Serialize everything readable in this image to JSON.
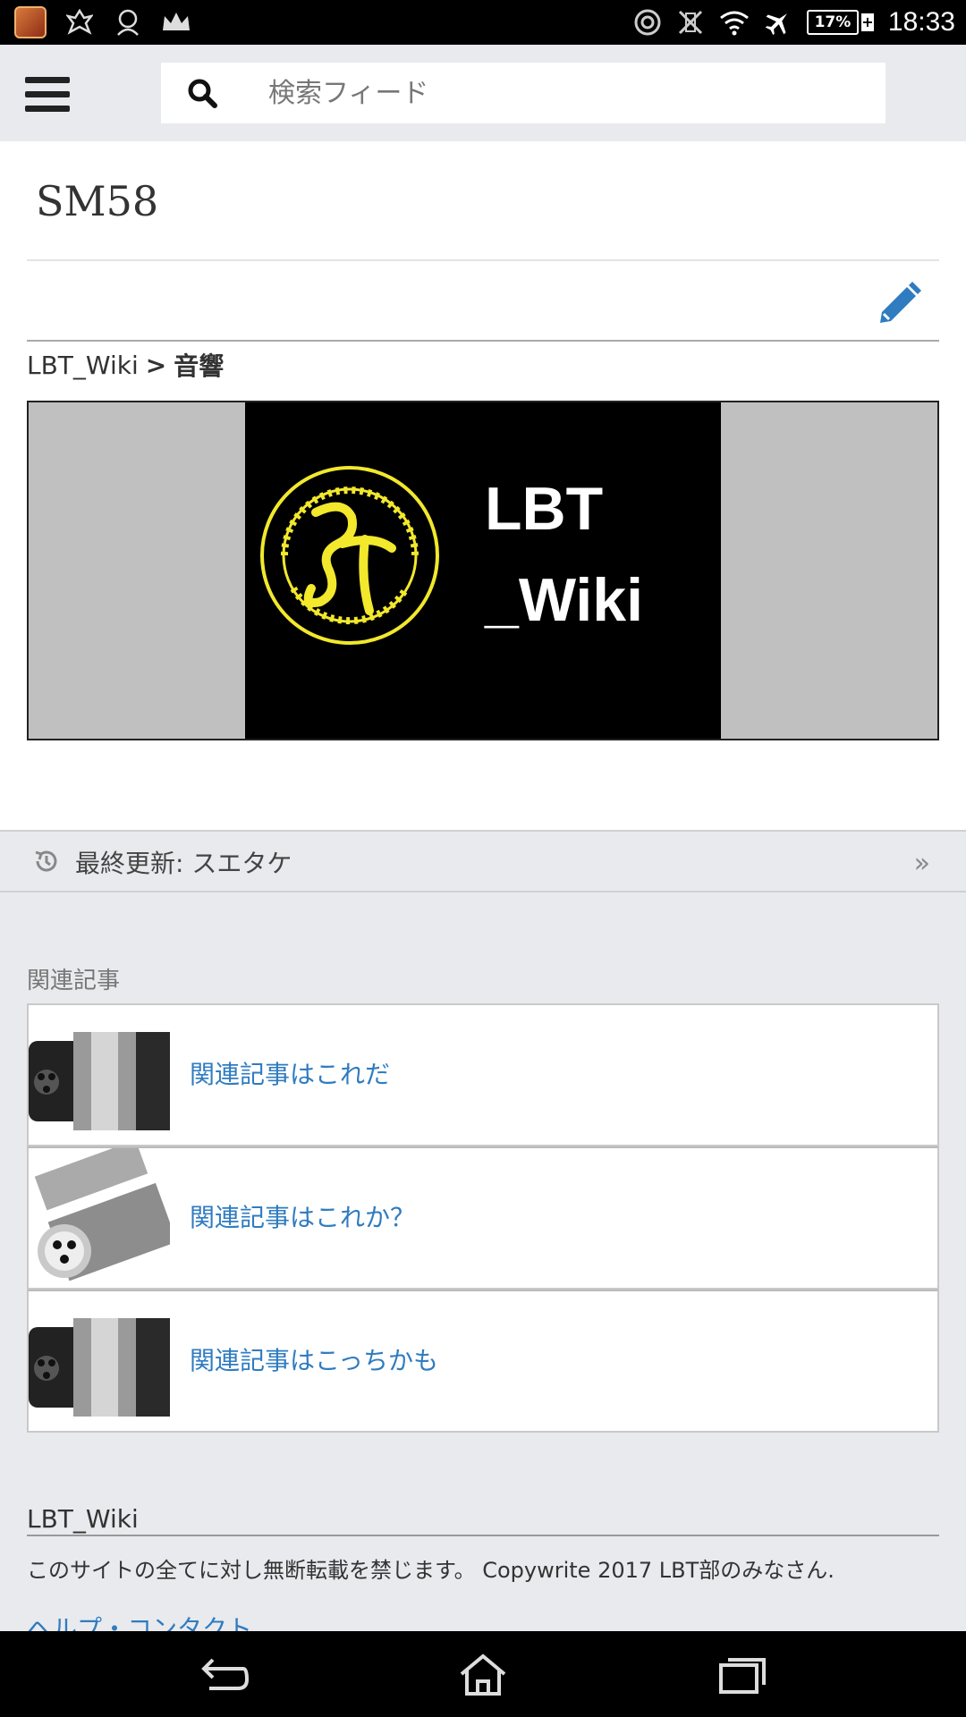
{
  "status_bar": {
    "battery": "17%",
    "time": "18:33"
  },
  "header": {
    "search_placeholder": "検索フィード"
  },
  "page": {
    "title": "SM58",
    "breadcrumb": {
      "root": "LBT_Wiki",
      "separator": ">",
      "current": "音響"
    },
    "banner": {
      "line1": "LBT",
      "line2": "_Wiki"
    },
    "last_updated": "最終更新: スエタケ"
  },
  "related": {
    "heading": "関連記事",
    "items": [
      {
        "label": "関連記事はこれだ"
      },
      {
        "label": "関連記事はこれか？"
      },
      {
        "label": "関連記事はこっちかも"
      }
    ]
  },
  "footer": {
    "title": "LBT_Wiki",
    "text": "このサイトの全てに対し無断転載を禁じます。 Copywrite 2017 LBT部のみなさん.",
    "link": "ヘルプ・コンタクト"
  },
  "colors": {
    "accent": "#2f7cc0",
    "logo_yellow": "#f2e82c",
    "background": "#e9eaee"
  }
}
